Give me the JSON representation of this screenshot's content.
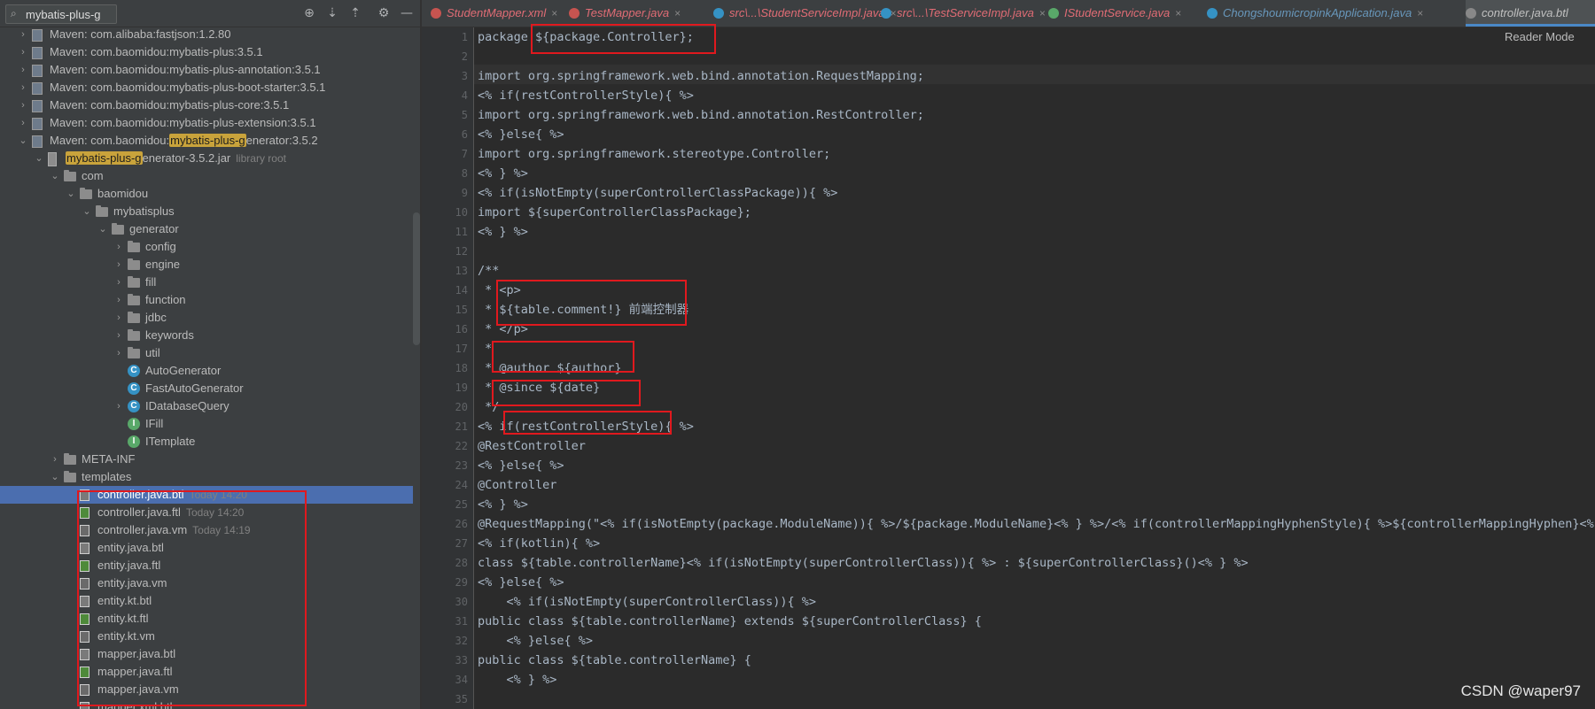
{
  "project_panel": {
    "search": {
      "value": "mybatis-plus-g"
    },
    "toolbar": {
      "locate": "⊕",
      "expand": "⇣",
      "collapse": "⇡",
      "settings": "⚙",
      "hide": "—"
    }
  },
  "tree": [
    {
      "indent": 0,
      "arrow": "›",
      "icon": "lib",
      "label": "Maven: com.alibaba:fastjson:1.2.80"
    },
    {
      "indent": 0,
      "arrow": "›",
      "icon": "lib",
      "label": "Maven: com.baomidou:mybatis-plus:3.5.1"
    },
    {
      "indent": 0,
      "arrow": "›",
      "icon": "lib",
      "label": "Maven: com.baomidou:mybatis-plus-annotation:3.5.1"
    },
    {
      "indent": 0,
      "arrow": "›",
      "icon": "lib",
      "label": "Maven: com.baomidou:mybatis-plus-boot-starter:3.5.1"
    },
    {
      "indent": 0,
      "arrow": "›",
      "icon": "lib",
      "label": "Maven: com.baomidou:mybatis-plus-core:3.5.1"
    },
    {
      "indent": 0,
      "arrow": "›",
      "icon": "lib",
      "label": "Maven: com.baomidou:mybatis-plus-extension:3.5.1"
    },
    {
      "indent": 0,
      "arrow": "⌄",
      "icon": "lib",
      "label": "Maven: com.baomidou:",
      "hl": "mybatis-plus-g",
      "rest": "enerator:3.5.2"
    },
    {
      "indent": 1,
      "arrow": "⌄",
      "icon": "jar",
      "label": "",
      "hl": "mybatis-plus-g",
      "rest": "enerator-3.5.2.jar",
      "suffix": "library root"
    },
    {
      "indent": 2,
      "arrow": "⌄",
      "icon": "folder",
      "label": "com"
    },
    {
      "indent": 3,
      "arrow": "⌄",
      "icon": "folder",
      "label": "baomidou"
    },
    {
      "indent": 4,
      "arrow": "⌄",
      "icon": "folder",
      "label": "mybatisplus"
    },
    {
      "indent": 5,
      "arrow": "⌄",
      "icon": "folder",
      "label": "generator"
    },
    {
      "indent": 6,
      "arrow": "›",
      "icon": "folder",
      "label": "config"
    },
    {
      "indent": 6,
      "arrow": "›",
      "icon": "folder",
      "label": "engine"
    },
    {
      "indent": 6,
      "arrow": "›",
      "icon": "folder",
      "label": "fill"
    },
    {
      "indent": 6,
      "arrow": "›",
      "icon": "folder",
      "label": "function"
    },
    {
      "indent": 6,
      "arrow": "›",
      "icon": "folder",
      "label": "jdbc"
    },
    {
      "indent": 6,
      "arrow": "›",
      "icon": "folder",
      "label": "keywords"
    },
    {
      "indent": 6,
      "arrow": "›",
      "icon": "folder",
      "label": "util"
    },
    {
      "indent": 6,
      "arrow": "",
      "icon": "cls",
      "glyph": "C",
      "label": "AutoGenerator"
    },
    {
      "indent": 6,
      "arrow": "",
      "icon": "cls",
      "glyph": "C",
      "label": "FastAutoGenerator"
    },
    {
      "indent": 6,
      "arrow": "›",
      "icon": "cls",
      "glyph": "C",
      "label": "IDatabaseQuery"
    },
    {
      "indent": 6,
      "arrow": "",
      "icon": "intf",
      "glyph": "I",
      "label": "IFill"
    },
    {
      "indent": 6,
      "arrow": "",
      "icon": "intf",
      "glyph": "I",
      "label": "ITemplate"
    },
    {
      "indent": 2,
      "arrow": "›",
      "icon": "folder",
      "label": "META-INF"
    },
    {
      "indent": 2,
      "arrow": "⌄",
      "icon": "folder",
      "label": "templates"
    },
    {
      "indent": 3,
      "arrow": "",
      "icon": "btl",
      "label": "controller.java.btl",
      "suffix": "Today 14:20",
      "selected": true
    },
    {
      "indent": 3,
      "arrow": "",
      "icon": "ftl",
      "label": "controller.java.ftl",
      "suffix": "Today 14:20"
    },
    {
      "indent": 3,
      "arrow": "",
      "icon": "vm",
      "label": "controller.java.vm",
      "suffix": "Today 14:19"
    },
    {
      "indent": 3,
      "arrow": "",
      "icon": "btl",
      "label": "entity.java.btl"
    },
    {
      "indent": 3,
      "arrow": "",
      "icon": "ftl",
      "label": "entity.java.ftl"
    },
    {
      "indent": 3,
      "arrow": "",
      "icon": "vm",
      "label": "entity.java.vm"
    },
    {
      "indent": 3,
      "arrow": "",
      "icon": "btl",
      "label": "entity.kt.btl"
    },
    {
      "indent": 3,
      "arrow": "",
      "icon": "ftl",
      "label": "entity.kt.ftl"
    },
    {
      "indent": 3,
      "arrow": "",
      "icon": "vm",
      "label": "entity.kt.vm"
    },
    {
      "indent": 3,
      "arrow": "",
      "icon": "btl",
      "label": "mapper.java.btl"
    },
    {
      "indent": 3,
      "arrow": "",
      "icon": "ftl",
      "label": "mapper.java.ftl"
    },
    {
      "indent": 3,
      "arrow": "",
      "icon": "vm",
      "label": "mapper.java.vm"
    },
    {
      "indent": 3,
      "arrow": "",
      "icon": "btl",
      "label": "mapper.xml.btl"
    }
  ],
  "tabs": [
    {
      "label": "StudentMapper.xml",
      "color": "#e06c75",
      "icon": "xml-icon"
    },
    {
      "label": "TestMapper.java",
      "color": "#e06c75",
      "icon": "java-icon"
    },
    {
      "label": "src\\...\\StudentServiceImpl.java",
      "color": "#e06c75",
      "icon": "class-icon"
    },
    {
      "label": "src\\...\\TestServiceImpl.java",
      "color": "#e06c75",
      "icon": "class-icon"
    },
    {
      "label": "IStudentService.java",
      "color": "#e06c75",
      "icon": "interface-icon"
    },
    {
      "label": "ChongshoumicropinkApplication.java",
      "color": "#6897bb",
      "icon": "spring-icon"
    },
    {
      "label": "controller.java.btl",
      "color": "#c0c0c0",
      "icon": "file-icon",
      "active": true
    }
  ],
  "tab_close": "×",
  "editor": {
    "reader_mode": "Reader Mode",
    "lines": [
      "package ${package.Controller};",
      "",
      "import org.springframework.web.bind.annotation.RequestMapping;",
      "<% if(restControllerStyle){ %>",
      "import org.springframework.web.bind.annotation.RestController;",
      "<% }else{ %>",
      "import org.springframework.stereotype.Controller;",
      "<% } %>",
      "<% if(isNotEmpty(superControllerClassPackage)){ %>",
      "import ${superControllerClassPackage};",
      "<% } %>",
      "",
      "/**",
      " * <p>",
      " * ${table.comment!} 前端控制器",
      " * </p>",
      " *",
      " * @author ${author}",
      " * @since ${date}",
      " */",
      "<% if(restControllerStyle){ %>",
      "@RestController",
      "<% }else{ %>",
      "@Controller",
      "<% } %>",
      "@RequestMapping(\"<% if(isNotEmpty(package.ModuleName)){ %>/${package.ModuleName}<% } %>/<% if(controllerMappingHyphenStyle){ %>${controllerMappingHyphen}<% }else{ %>${table.entityPath}<% } %>\")",
      "<% if(kotlin){ %>",
      "class ${table.controllerName}<% if(isNotEmpty(superControllerClass)){ %> : ${superControllerClass}()<% } %>",
      "<% }else{ %>",
      "    <% if(isNotEmpty(superControllerClass)){ %>",
      "public class ${table.controllerName} extends ${superControllerClass} {",
      "    <% }else{ %>",
      "public class ${table.controllerName} {",
      "    <% } %>",
      ""
    ]
  },
  "watermark": "CSDN @waper97"
}
